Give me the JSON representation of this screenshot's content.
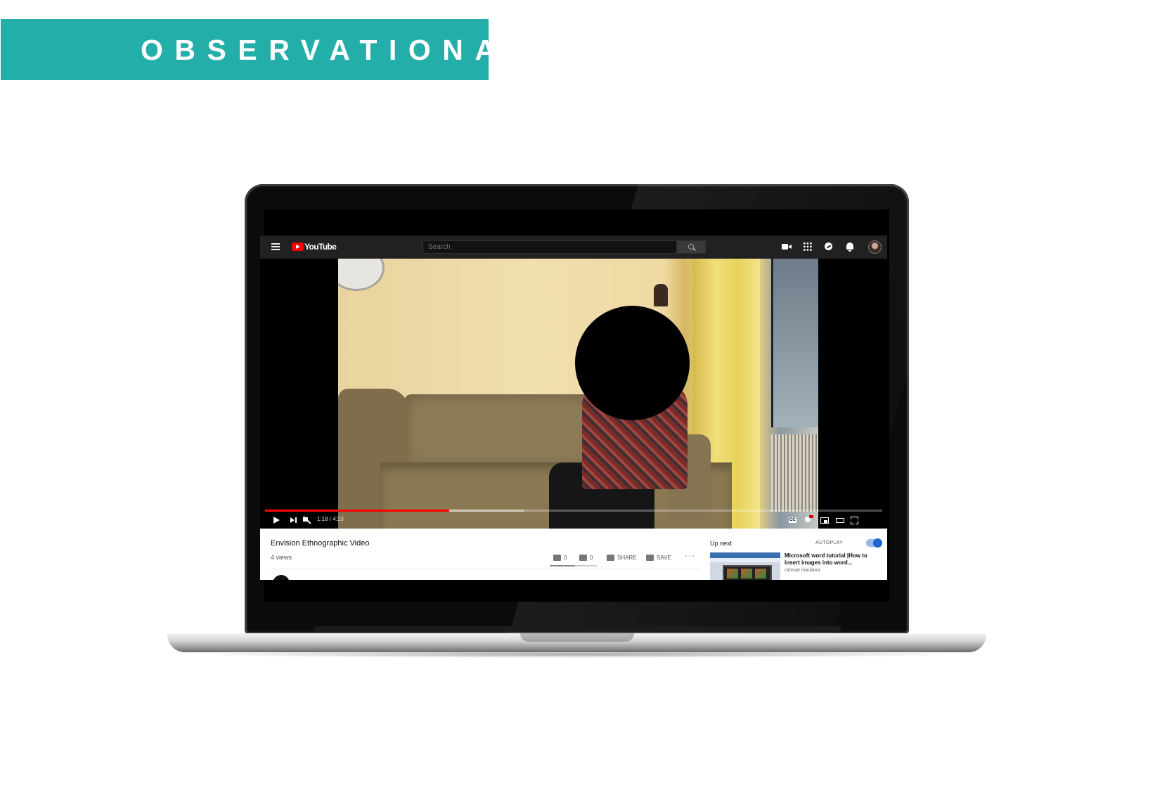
{
  "banner": {
    "text": "OBSERVATIONAL",
    "color": "#23aeaa"
  },
  "youtube": {
    "header": {
      "logo_text": "YouTube",
      "search_placeholder": "Search",
      "icons": [
        "menu-icon",
        "youtube-logo-icon",
        "search-icon",
        "create-video-icon",
        "apps-icon",
        "messages-icon",
        "notifications-icon",
        "avatar"
      ]
    },
    "player": {
      "time": "1:18 / 4:23",
      "progress_fraction": 0.298,
      "buffered_fraction": 0.42,
      "controls": [
        "play-icon",
        "next-icon",
        "mute-icon",
        "captions-icon",
        "settings-icon",
        "miniplayer-icon",
        "theater-icon",
        "fullscreen-icon"
      ]
    },
    "video": {
      "title": "Envision Ethnographic Video",
      "views": "4 views",
      "likes": "0",
      "dislikes": "0",
      "share_label": "SHARE",
      "save_label": "SAVE",
      "more_label": "···"
    },
    "sidebar": {
      "up_next_label": "Up next",
      "autoplay_label": "AUTOPLAY",
      "autoplay_on": true,
      "recommendation": {
        "title": "Microsoft word tutorial |How to insert images into word...",
        "channel": "rahmat maulana"
      }
    }
  }
}
